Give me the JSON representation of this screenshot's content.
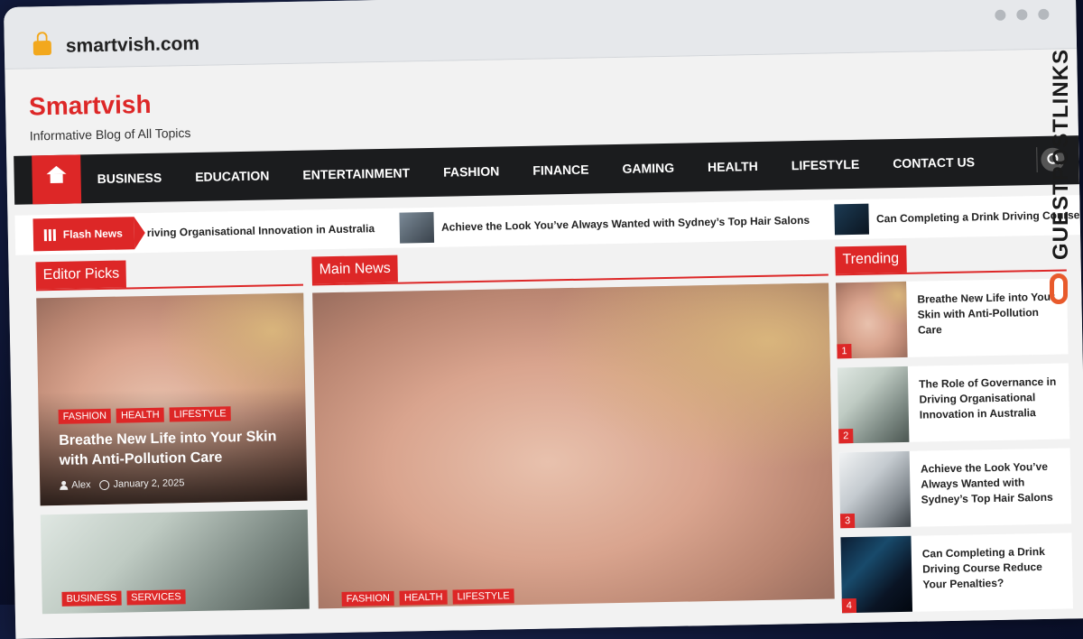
{
  "browser": {
    "url": "smartvish.com"
  },
  "site": {
    "name": "Smartvish",
    "tagline": "Informative Blog of All Topics"
  },
  "nav": {
    "items": [
      "BUSINESS",
      "EDUCATION",
      "ENTERTAINMENT",
      "FASHION",
      "FINANCE",
      "GAMING",
      "HEALTH",
      "LIFESTYLE",
      "CONTACT US"
    ]
  },
  "flash": {
    "label": "Flash News",
    "items": [
      "riving Organisational Innovation in Australia",
      "Achieve the Look You’ve Always Wanted with Sydney’s Top Hair Salons",
      "Can Completing a Drink Driving Course Re"
    ]
  },
  "sections": {
    "editor_picks": "Editor Picks",
    "main_news": "Main News",
    "trending": "Trending"
  },
  "editor_picks": [
    {
      "tags": [
        "FASHION",
        "HEALTH",
        "LIFESTYLE"
      ],
      "title": "Breathe New Life into Your Skin with Anti-Pollution Care",
      "author": "Alex",
      "date": "January 2, 2025"
    },
    {
      "tags": [
        "BUSINESS",
        "SERVICES"
      ]
    }
  ],
  "main_news": {
    "tags": [
      "FASHION",
      "HEALTH",
      "LIFESTYLE"
    ]
  },
  "trending": [
    {
      "num": "1",
      "title": "Breathe New Life into Your Skin with Anti-Pollution Care"
    },
    {
      "num": "2",
      "title": "The Role of Governance in Driving Organisational Innovation in Australia"
    },
    {
      "num": "3",
      "title": "Achieve the Look You’ve Always Wanted with Sydney’s Top Hair Salons"
    },
    {
      "num": "4",
      "title": "Can Completing a Drink Driving Course Reduce Your Penalties?"
    }
  ],
  "watermark": {
    "text": "GUESTPOSTLINKS"
  },
  "colors": {
    "accent": "#dd2727",
    "nav_bg": "#1b1c1e"
  }
}
